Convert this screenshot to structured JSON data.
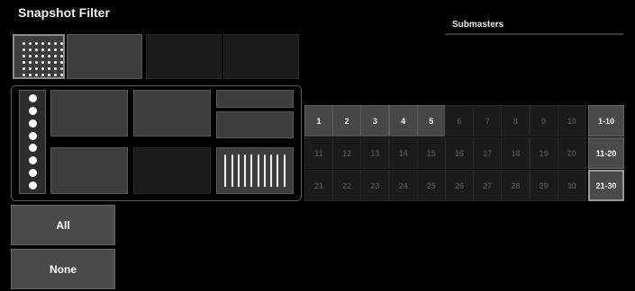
{
  "title": "Snapshot Filter",
  "submasters": {
    "title": "Submasters",
    "cells": [
      "1",
      "2",
      "3",
      "4",
      "5",
      "6",
      "7",
      "8",
      "9",
      "10",
      "11",
      "12",
      "13",
      "14",
      "15",
      "16",
      "17",
      "18",
      "19",
      "20",
      "21",
      "22",
      "23",
      "24",
      "25",
      "26",
      "27",
      "28",
      "29",
      "30"
    ],
    "active_count": 5,
    "pages": [
      "1-10",
      "11-20",
      "21-30"
    ]
  },
  "buttons": {
    "all": "All",
    "none": "None"
  }
}
